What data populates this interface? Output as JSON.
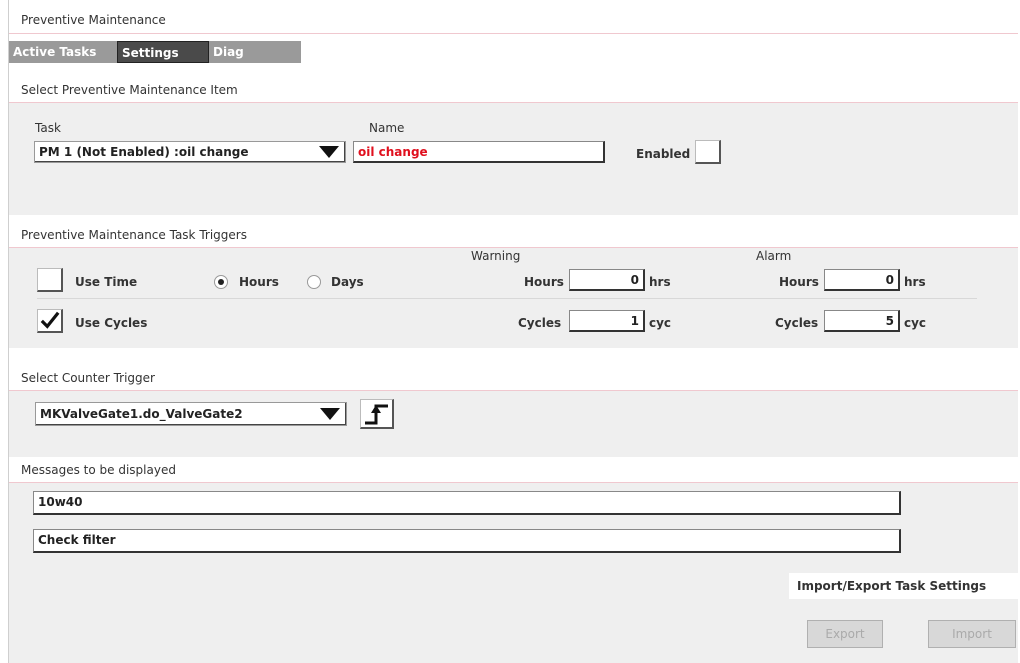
{
  "window": {
    "title": "Preventive Maintenance"
  },
  "tabs": [
    {
      "label": "Active Tasks"
    },
    {
      "label": "Settings"
    },
    {
      "label": "Diag"
    }
  ],
  "select_item": {
    "header": "Select Preventive Maintenance Item",
    "task_label": "Task",
    "task_value": "PM 1 (Not Enabled) :oil change",
    "name_label": "Name",
    "name_value": "oil change",
    "enabled_label": "Enabled"
  },
  "triggers": {
    "header": "Preventive Maintenance Task Triggers",
    "warning_label": "Warning",
    "alarm_label": "Alarm",
    "use_time_label": "Use Time",
    "hours_label": "Hours",
    "days_label": "Days",
    "use_cycles_label": "Use Cycles",
    "warning_hours_label": "Hours",
    "warning_hours_value": "0",
    "warning_hours_unit": "hrs",
    "warning_cycles_label": "Cycles",
    "warning_cycles_value": "1",
    "warning_cycles_unit": "cyc",
    "alarm_hours_label": "Hours",
    "alarm_hours_value": "0",
    "alarm_hours_unit": "hrs",
    "alarm_cycles_label": "Cycles",
    "alarm_cycles_value": "5",
    "alarm_cycles_unit": "cyc",
    "use_time_checked": false,
    "use_cycles_checked": true,
    "selected_unit": "Hours"
  },
  "counter": {
    "header": "Select Counter Trigger",
    "value": "MKValveGate1.do_ValveGate2"
  },
  "messages": {
    "header": "Messages to be displayed",
    "line1": "10w40",
    "line2": "Check filter"
  },
  "import_export": {
    "label": "Import/Export Task Settings",
    "export_label": "Export",
    "import_label": "Import"
  },
  "colors": {
    "name_text": "#e0101e",
    "accent_line": "#f0c8cf"
  }
}
